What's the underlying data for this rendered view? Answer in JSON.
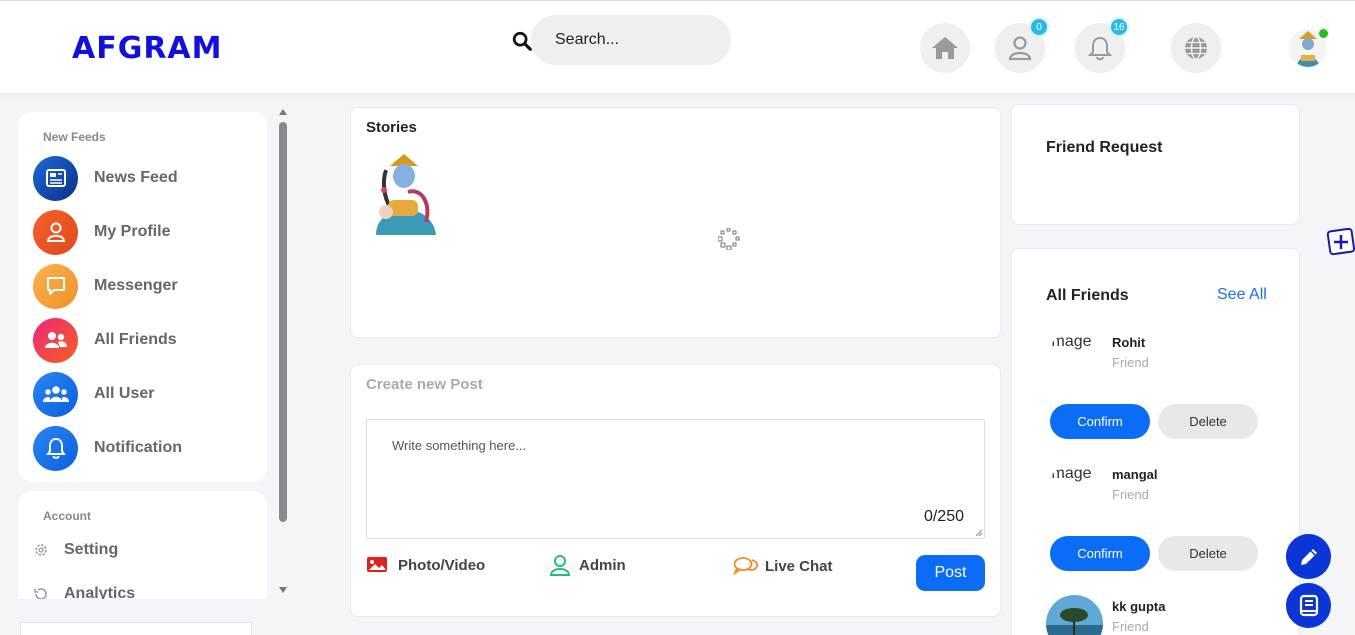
{
  "header": {
    "logo": "AFGRAM",
    "search_placeholder": "Search...",
    "friends_badge": "0",
    "notifications_badge": "16"
  },
  "sidebar": {
    "feeds_heading": "New Feeds",
    "items": [
      {
        "label": "News Feed",
        "icon": "newspaper-icon"
      },
      {
        "label": "My Profile",
        "icon": "user-icon"
      },
      {
        "label": "Messenger",
        "icon": "chat-icon"
      },
      {
        "label": "All Friends",
        "icon": "friends-icon"
      },
      {
        "label": "All User",
        "icon": "users-icon"
      },
      {
        "label": "Notification",
        "icon": "bell-icon"
      }
    ],
    "account_heading": "Account",
    "account_items": [
      {
        "label": "Setting",
        "icon": "gear-icon"
      },
      {
        "label": "Analytics",
        "icon": "history-icon"
      }
    ]
  },
  "stories": {
    "title": "Stories"
  },
  "create_post": {
    "title": "Create new Post",
    "placeholder": "Write something here...",
    "counter": "0/250",
    "actions": {
      "photo": "Photo/Video",
      "admin": "Admin",
      "live_chat": "Live Chat"
    },
    "post_label": "Post"
  },
  "friend_request": {
    "title": "Friend Request"
  },
  "all_friends": {
    "title": "All Friends",
    "see_all": "See All",
    "image_alt": "image",
    "confirm_label": "Confirm",
    "delete_label": "Delete",
    "friends": [
      {
        "name": "Rohit",
        "status": "Friend"
      },
      {
        "name": "mangal",
        "status": "Friend"
      },
      {
        "name": "kk gupta",
        "status": "Friend"
      }
    ]
  },
  "colors": {
    "brand": "#1010e0",
    "primary": "#0b6cf5",
    "badge": "#29b9e6"
  }
}
